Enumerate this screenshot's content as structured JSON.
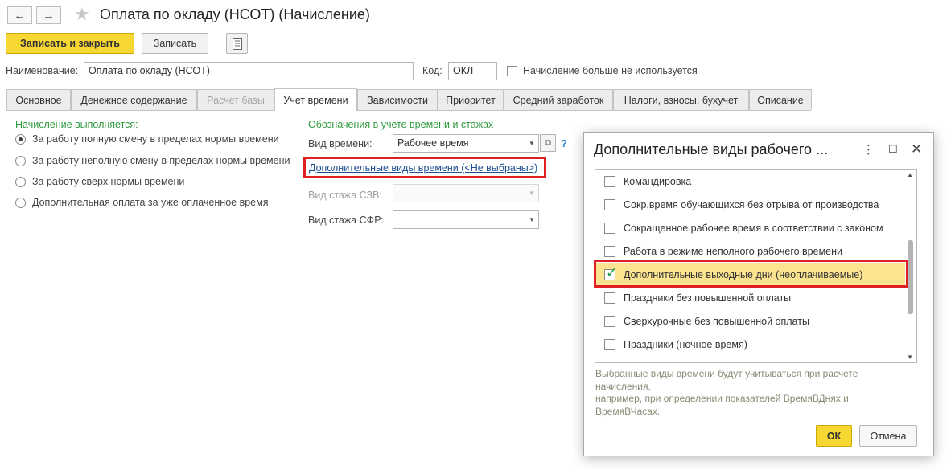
{
  "window": {
    "title": "Оплата по окладу (НСОТ) (Начисление)",
    "back_icon": "arrow-left",
    "forward_icon": "arrow-right",
    "favorite_icon": "star"
  },
  "toolbar": {
    "save_close_label": "Записать и закрыть",
    "save_label": "Записать",
    "report_icon": "document-list"
  },
  "header": {
    "name_label": "Наименование:",
    "name_value": "Оплата по окладу (НСОТ)",
    "code_label": "Код:",
    "code_value": "ОКЛ",
    "unused_label": "Начисление больше не используется",
    "unused_checked": false
  },
  "tabs": [
    {
      "label": "Основное",
      "active": false,
      "disabled": false
    },
    {
      "label": "Денежное содержание",
      "active": false,
      "disabled": false
    },
    {
      "label": "Расчет базы",
      "active": false,
      "disabled": true
    },
    {
      "label": "Учет времени",
      "active": true,
      "disabled": false
    },
    {
      "label": "Зависимости",
      "active": false,
      "disabled": false
    },
    {
      "label": "Приоритет",
      "active": false,
      "disabled": false
    },
    {
      "label": "Средний заработок",
      "active": false,
      "disabled": false
    },
    {
      "label": "Налоги, взносы, бухучет",
      "active": false,
      "disabled": false
    },
    {
      "label": "Описание",
      "active": false,
      "disabled": false
    }
  ],
  "left_panel": {
    "heading": "Начисление выполняется:",
    "options": [
      {
        "label": "За работу полную смену в пределах нормы времени",
        "selected": true
      },
      {
        "label": "За работу неполную смену в пределах нормы времени",
        "selected": false
      },
      {
        "label": "За работу сверх нормы времени",
        "selected": false
      },
      {
        "label": "Дополнительная оплата за уже оплаченное время",
        "selected": false
      }
    ]
  },
  "right_panel": {
    "heading": "Обозначения в учете времени и стажах",
    "time_type_label": "Вид времени:",
    "time_type_value": "Рабочее время",
    "help_mark": "?",
    "extra_types_link": "Дополнительные виды времени (<Не выбраны>)",
    "szv_label": "Вид стажа СЗВ:",
    "szv_value": "",
    "sfr_label": "Вид стажа СФР:",
    "sfr_value": ""
  },
  "dialog": {
    "title": "Дополнительные виды рабочего ...",
    "more_icon": "vertical-dots",
    "maximize_icon": "square",
    "close_icon": "cross",
    "items": [
      {
        "label": "Командировка",
        "checked": false,
        "selected": false
      },
      {
        "label": "Сокр.время обучающихся без отрыва от производства",
        "checked": false,
        "selected": false
      },
      {
        "label": "Сокращенное рабочее время в соответствии с законом",
        "checked": false,
        "selected": false
      },
      {
        "label": "Работа в режиме неполного рабочего времени",
        "checked": false,
        "selected": false
      },
      {
        "label": "Дополнительные выходные дни (неоплачиваемые)",
        "checked": true,
        "selected": true
      },
      {
        "label": "Праздники без повышенной оплаты",
        "checked": false,
        "selected": false
      },
      {
        "label": "Сверхурочные без повышенной оплаты",
        "checked": false,
        "selected": false
      },
      {
        "label": "Праздники (ночное время)",
        "checked": false,
        "selected": false
      }
    ],
    "hint_lines": [
      "Выбранные виды времени будут учитываться при расчете",
      "начисления,",
      "например, при определении показателей ВремяВДнях и",
      "ВремяВЧасах."
    ],
    "ok_label": "ОК",
    "cancel_label": "Отмена"
  },
  "colors": {
    "primary_button": "#f7d732",
    "accent_green": "#2e9a3e",
    "link_blue": "#1d4f91",
    "highlight_red": "#e02020",
    "selected_row": "#fbe38f"
  }
}
